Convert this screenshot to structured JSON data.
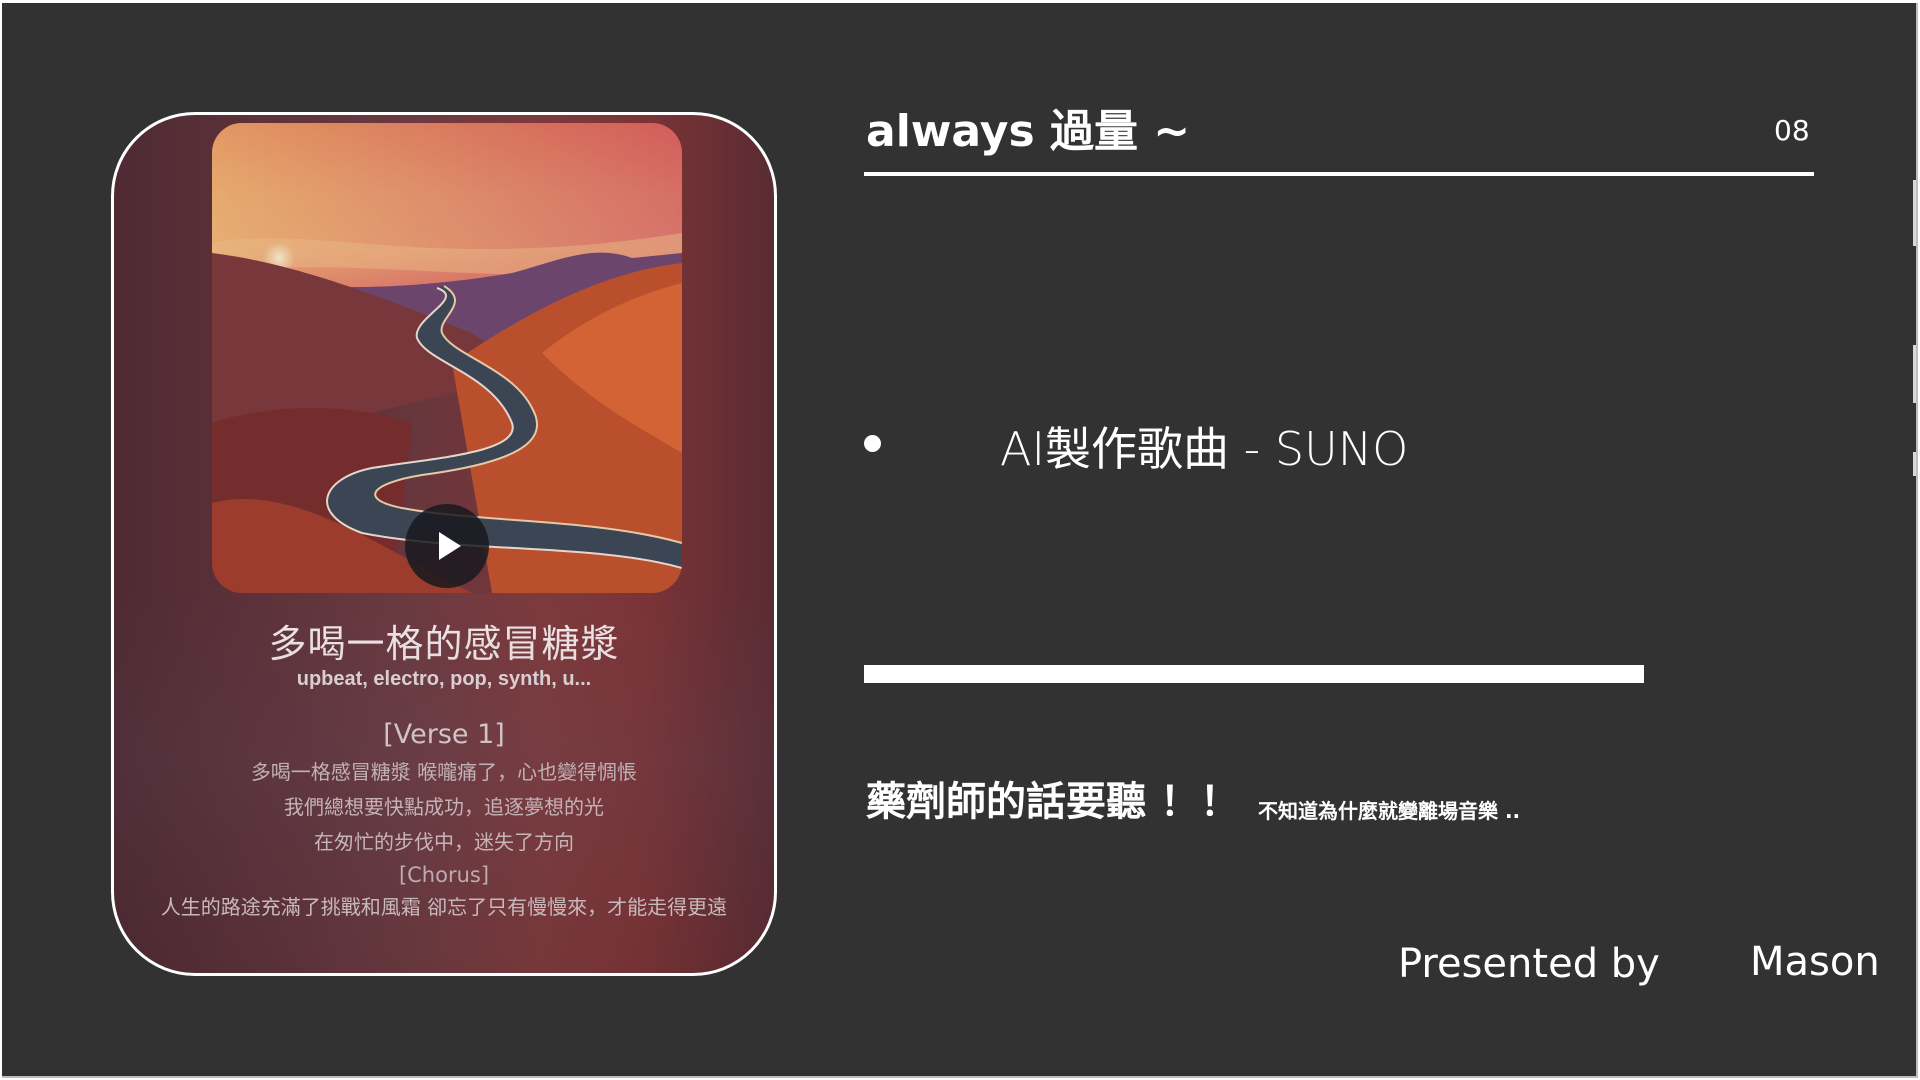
{
  "slide": {
    "title": "always 過量 ~",
    "number": "08",
    "bullet": "AI製作歌曲  - SUNO",
    "progress_percent": 100,
    "headline": "藥劑師的話要聽 ！！",
    "subnote": "不知道為什麼就變離場音樂 ..",
    "presented_label": "Presented by",
    "presenter": "Mason"
  },
  "song_card": {
    "cover_icon": "winding-road-sunset-image",
    "play_icon": "play-icon",
    "title": "多喝一格的感冒糖漿",
    "tags": "upbeat, electro, pop, synth, u...",
    "lyrics": {
      "verse_label": "[Verse 1]",
      "verse_lines": [
        "多喝一格感冒糖漿 喉嚨痛了，心也變得惆悵",
        "我們總想要快點成功，追逐夢想的光",
        "在匆忙的步伐中，迷失了方向"
      ],
      "chorus_label": "[Chorus]",
      "chorus_lines": [
        "人生的路途充滿了挑戰和風霜 卻忘了只有慢慢來，才能走得更遠"
      ]
    }
  },
  "colors": {
    "background": "#323232",
    "text": "#ffffff",
    "card_tint": "#6b3a40"
  }
}
